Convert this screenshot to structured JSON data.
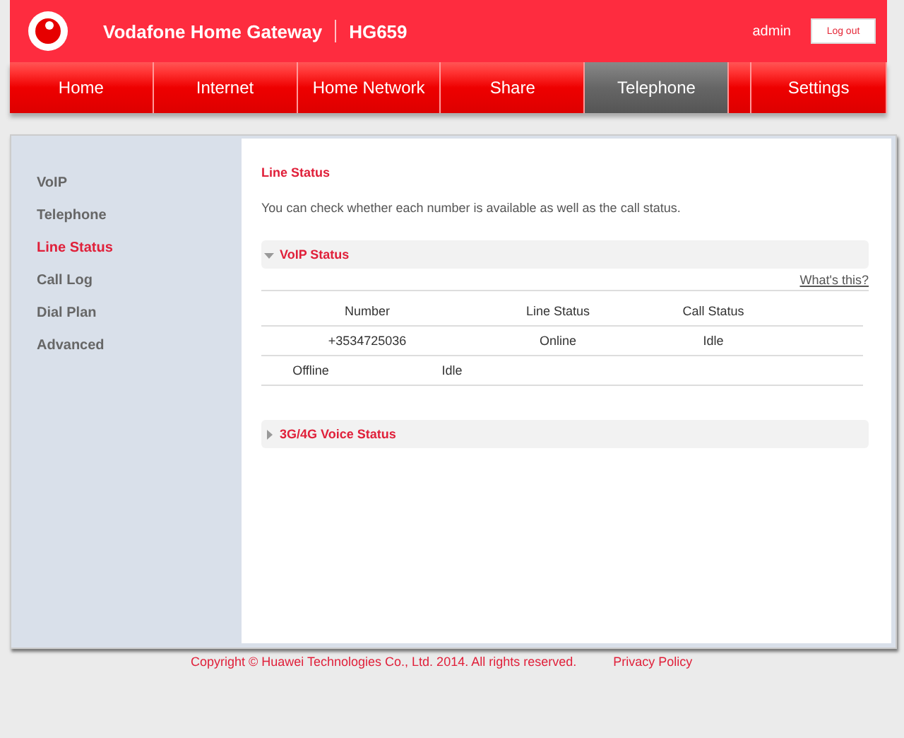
{
  "header": {
    "title": "Vodafone Home Gateway",
    "model": "HG659",
    "user": "admin",
    "logout": "Log out"
  },
  "tabs": [
    {
      "label": "Home",
      "selected": false
    },
    {
      "label": "Internet",
      "selected": false
    },
    {
      "label": "Home Network",
      "selected": false
    },
    {
      "label": "Share",
      "selected": false
    },
    {
      "label": "Telephone",
      "selected": true
    },
    {
      "label": "Settings",
      "selected": false
    }
  ],
  "sidebar": {
    "items": [
      {
        "label": "VoIP",
        "selected": false
      },
      {
        "label": "Telephone",
        "selected": false
      },
      {
        "label": "Line Status",
        "selected": true
      },
      {
        "label": "Call Log",
        "selected": false
      },
      {
        "label": "Dial Plan",
        "selected": false
      },
      {
        "label": "Advanced",
        "selected": false
      }
    ]
  },
  "content": {
    "title": "Line Status",
    "description": "You can check whether each number is available as well as the call status.",
    "sections": [
      {
        "title": "VoIP Status",
        "expanded": true,
        "help_link": "What's this?",
        "table": {
          "columns": [
            "Number",
            "Line Status",
            "Call Status"
          ],
          "rows": [
            [
              "+3534725036",
              "Online",
              "Idle"
            ],
            [
              "Offline",
              "Idle"
            ]
          ]
        }
      },
      {
        "title": "3G/4G Voice Status",
        "expanded": false
      }
    ]
  },
  "footer": {
    "copyright": "Copyright © Huawei Technologies Co., Ltd. 2014. All rights reserved.",
    "privacy": "Privacy Policy"
  }
}
